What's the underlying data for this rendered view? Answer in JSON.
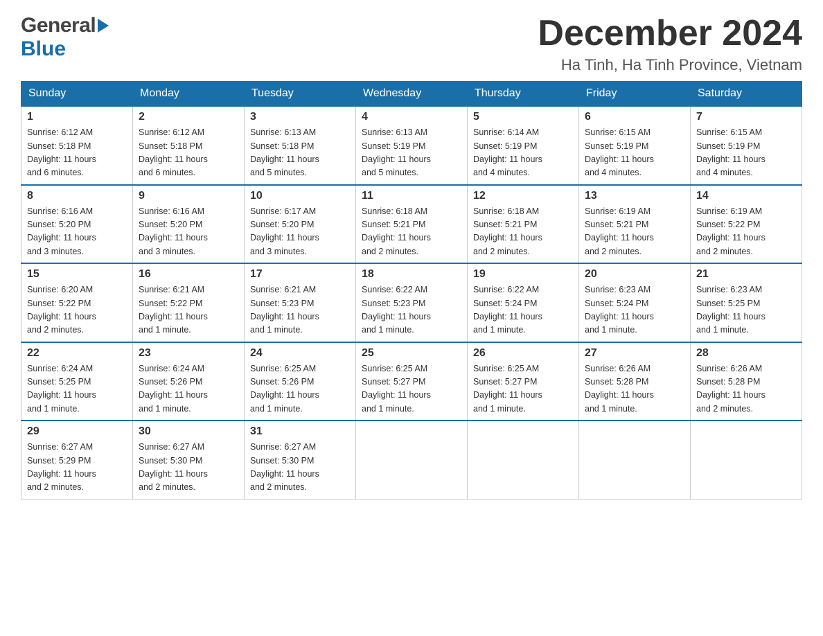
{
  "header": {
    "logo": {
      "general_text": "General",
      "blue_text": "Blue"
    },
    "title": "December 2024",
    "location": "Ha Tinh, Ha Tinh Province, Vietnam"
  },
  "calendar": {
    "days_of_week": [
      "Sunday",
      "Monday",
      "Tuesday",
      "Wednesday",
      "Thursday",
      "Friday",
      "Saturday"
    ],
    "weeks": [
      [
        {
          "day": "1",
          "sunrise": "6:12 AM",
          "sunset": "5:18 PM",
          "daylight": "11 hours and 6 minutes."
        },
        {
          "day": "2",
          "sunrise": "6:12 AM",
          "sunset": "5:18 PM",
          "daylight": "11 hours and 6 minutes."
        },
        {
          "day": "3",
          "sunrise": "6:13 AM",
          "sunset": "5:18 PM",
          "daylight": "11 hours and 5 minutes."
        },
        {
          "day": "4",
          "sunrise": "6:13 AM",
          "sunset": "5:19 PM",
          "daylight": "11 hours and 5 minutes."
        },
        {
          "day": "5",
          "sunrise": "6:14 AM",
          "sunset": "5:19 PM",
          "daylight": "11 hours and 4 minutes."
        },
        {
          "day": "6",
          "sunrise": "6:15 AM",
          "sunset": "5:19 PM",
          "daylight": "11 hours and 4 minutes."
        },
        {
          "day": "7",
          "sunrise": "6:15 AM",
          "sunset": "5:19 PM",
          "daylight": "11 hours and 4 minutes."
        }
      ],
      [
        {
          "day": "8",
          "sunrise": "6:16 AM",
          "sunset": "5:20 PM",
          "daylight": "11 hours and 3 minutes."
        },
        {
          "day": "9",
          "sunrise": "6:16 AM",
          "sunset": "5:20 PM",
          "daylight": "11 hours and 3 minutes."
        },
        {
          "day": "10",
          "sunrise": "6:17 AM",
          "sunset": "5:20 PM",
          "daylight": "11 hours and 3 minutes."
        },
        {
          "day": "11",
          "sunrise": "6:18 AM",
          "sunset": "5:21 PM",
          "daylight": "11 hours and 2 minutes."
        },
        {
          "day": "12",
          "sunrise": "6:18 AM",
          "sunset": "5:21 PM",
          "daylight": "11 hours and 2 minutes."
        },
        {
          "day": "13",
          "sunrise": "6:19 AM",
          "sunset": "5:21 PM",
          "daylight": "11 hours and 2 minutes."
        },
        {
          "day": "14",
          "sunrise": "6:19 AM",
          "sunset": "5:22 PM",
          "daylight": "11 hours and 2 minutes."
        }
      ],
      [
        {
          "day": "15",
          "sunrise": "6:20 AM",
          "sunset": "5:22 PM",
          "daylight": "11 hours and 2 minutes."
        },
        {
          "day": "16",
          "sunrise": "6:21 AM",
          "sunset": "5:22 PM",
          "daylight": "11 hours and 1 minute."
        },
        {
          "day": "17",
          "sunrise": "6:21 AM",
          "sunset": "5:23 PM",
          "daylight": "11 hours and 1 minute."
        },
        {
          "day": "18",
          "sunrise": "6:22 AM",
          "sunset": "5:23 PM",
          "daylight": "11 hours and 1 minute."
        },
        {
          "day": "19",
          "sunrise": "6:22 AM",
          "sunset": "5:24 PM",
          "daylight": "11 hours and 1 minute."
        },
        {
          "day": "20",
          "sunrise": "6:23 AM",
          "sunset": "5:24 PM",
          "daylight": "11 hours and 1 minute."
        },
        {
          "day": "21",
          "sunrise": "6:23 AM",
          "sunset": "5:25 PM",
          "daylight": "11 hours and 1 minute."
        }
      ],
      [
        {
          "day": "22",
          "sunrise": "6:24 AM",
          "sunset": "5:25 PM",
          "daylight": "11 hours and 1 minute."
        },
        {
          "day": "23",
          "sunrise": "6:24 AM",
          "sunset": "5:26 PM",
          "daylight": "11 hours and 1 minute."
        },
        {
          "day": "24",
          "sunrise": "6:25 AM",
          "sunset": "5:26 PM",
          "daylight": "11 hours and 1 minute."
        },
        {
          "day": "25",
          "sunrise": "6:25 AM",
          "sunset": "5:27 PM",
          "daylight": "11 hours and 1 minute."
        },
        {
          "day": "26",
          "sunrise": "6:25 AM",
          "sunset": "5:27 PM",
          "daylight": "11 hours and 1 minute."
        },
        {
          "day": "27",
          "sunrise": "6:26 AM",
          "sunset": "5:28 PM",
          "daylight": "11 hours and 1 minute."
        },
        {
          "day": "28",
          "sunrise": "6:26 AM",
          "sunset": "5:28 PM",
          "daylight": "11 hours and 2 minutes."
        }
      ],
      [
        {
          "day": "29",
          "sunrise": "6:27 AM",
          "sunset": "5:29 PM",
          "daylight": "11 hours and 2 minutes."
        },
        {
          "day": "30",
          "sunrise": "6:27 AM",
          "sunset": "5:30 PM",
          "daylight": "11 hours and 2 minutes."
        },
        {
          "day": "31",
          "sunrise": "6:27 AM",
          "sunset": "5:30 PM",
          "daylight": "11 hours and 2 minutes."
        },
        null,
        null,
        null,
        null
      ]
    ],
    "labels": {
      "sunrise_prefix": "Sunrise: ",
      "sunset_prefix": "Sunset: ",
      "daylight_prefix": "Daylight: "
    }
  }
}
